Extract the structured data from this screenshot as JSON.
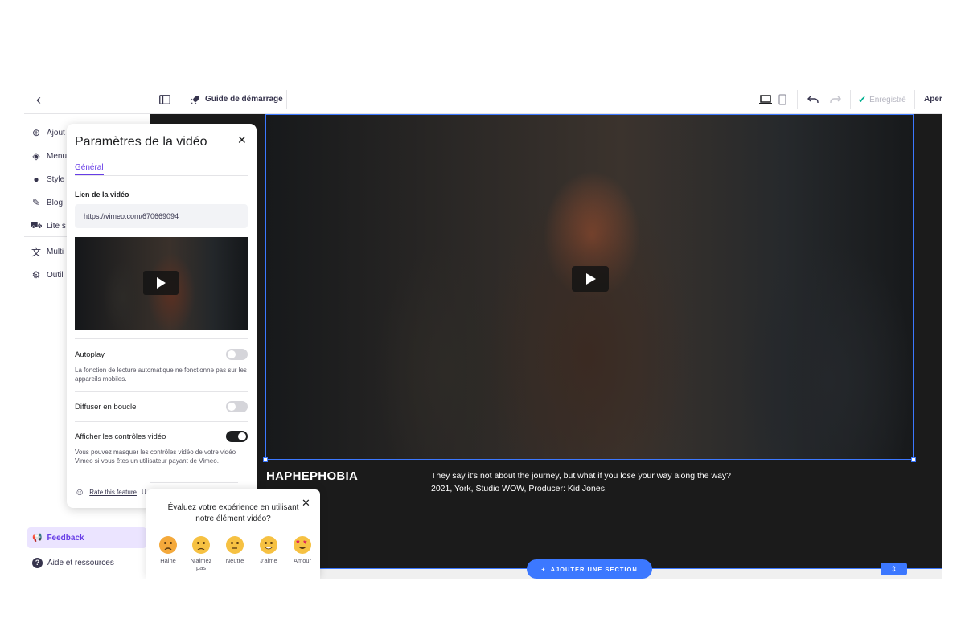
{
  "topbar": {
    "guide_label": "Guide de démarrage",
    "saved_label": "Enregistré",
    "preview_label": "Aper"
  },
  "sidebar": {
    "items": [
      {
        "label": "Ajout",
        "icon": "plus-circle-icon"
      },
      {
        "label": "Menu",
        "icon": "layers-icon"
      },
      {
        "label": "Style",
        "icon": "palette-icon"
      },
      {
        "label": "Blog",
        "icon": "edit-icon"
      },
      {
        "label": "Lite s",
        "icon": "cart-icon"
      },
      {
        "label": "Multi",
        "icon": "translate-icon"
      },
      {
        "label": "Outil",
        "icon": "robot-icon"
      }
    ],
    "feedback_label": "Feedback",
    "help_label": "Aide et ressources"
  },
  "panel": {
    "title": "Paramètres de la vidéo",
    "tab_general": "Général",
    "video_link_label": "Lien de la vidéo",
    "video_url": "https://vimeo.com/670669094",
    "autoplay_label": "Autoplay",
    "autoplay_desc": "La fonction de lecture automatique ne fonctionne pas sur les appareils mobiles.",
    "loop_label": "Diffuser en boucle",
    "controls_label": "Afficher les contrôles vidéo",
    "controls_desc": "Vous pouvez masquer les contrôles vidéo de votre vidéo Vimeo si vous êtes un utilisateur payant de Vimeo.",
    "rate_label": "Rate this feature",
    "rate_tail": "U"
  },
  "toggles": {
    "autoplay": false,
    "loop": false,
    "controls": true
  },
  "canvas": {
    "song_title": "HAPHEPHOBIA",
    "song_line1": "They say it's not about the journey, but what if you lose your way along the way?",
    "song_line2": "2021, York, Studio WOW, Producer: Kid Jones.",
    "add_section_label": "AJOUTER UNE SECTION"
  },
  "rating": {
    "question": "Évaluez votre expérience en utilisant notre élément vidéo?",
    "options": [
      "Haine",
      "N'aimez pas",
      "Neutre",
      "J'aime",
      "Amour"
    ]
  },
  "colors": {
    "accent": "#673de6",
    "primary_blue": "#3c78ff",
    "saved_green": "#00b090"
  }
}
